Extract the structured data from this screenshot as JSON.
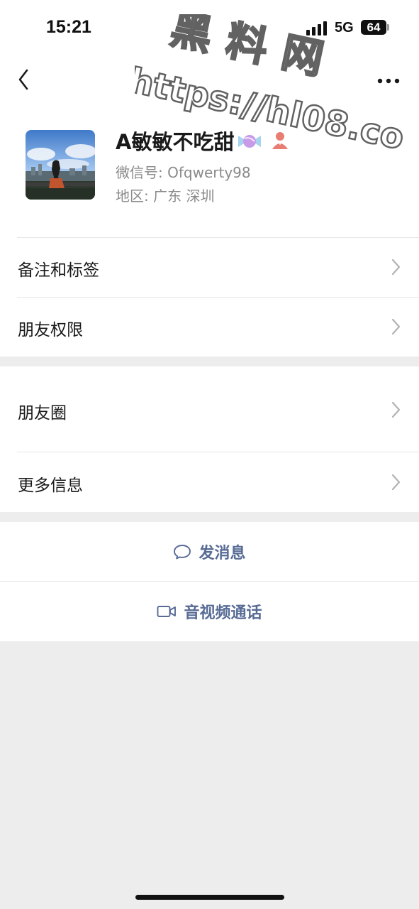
{
  "status_bar": {
    "time": "15:21",
    "network": "5G",
    "battery": "64"
  },
  "nav": {
    "back_icon": "chevron-left-icon",
    "more_icon": "ellipsis-icon"
  },
  "profile": {
    "name": "A敏敏不吃甜",
    "wechat_id_label": "微信号:",
    "wechat_id": "Ofqwerty98",
    "region_label": "地区:",
    "region": "广东 深圳",
    "badge_icons": [
      "candy-icon",
      "person-icon"
    ]
  },
  "menu": {
    "group1": [
      {
        "label": "备注和标签"
      },
      {
        "label": "朋友权限"
      }
    ],
    "group2": [
      {
        "label": "朋友圈"
      },
      {
        "label": "更多信息"
      }
    ]
  },
  "actions": {
    "send_message": "发消息",
    "video_call": "音视频通话"
  },
  "watermark": {
    "title": "黑料网",
    "url": "https://hl08.co"
  },
  "colors": {
    "link_blue": "#576b95",
    "background": "#ededed",
    "secondary_text": "#8a8a8a"
  }
}
